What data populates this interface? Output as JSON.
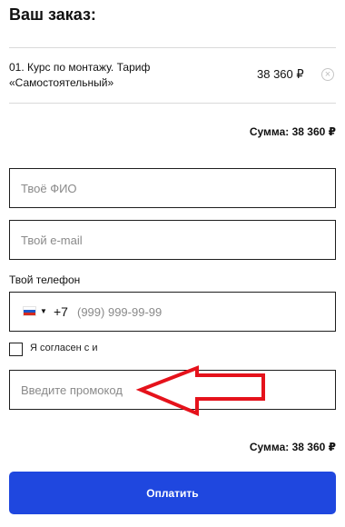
{
  "order": {
    "title": "Ваш заказ:",
    "item": {
      "name": "01. Курс по монтажу. Тариф «Самостоятельный»",
      "price": "38 360 ₽",
      "remove_icon": "close-circle-icon"
    },
    "sum_top": "Сумма: 38 360 ₽",
    "sum_bottom": "Сумма: 38 360 ₽"
  },
  "form": {
    "name_placeholder": "Твоё ФИО",
    "email_placeholder": "Твой e-mail",
    "phone_label": "Твой телефон",
    "phone_country_icon": "russia-flag-icon",
    "phone_code": "+7",
    "phone_placeholder": "(999) 999-99-99",
    "agree_label": "Я согласен с и",
    "agree_checked": false,
    "promo_placeholder": "Введите промокод"
  },
  "annotation": {
    "icon": "arrow-left-icon",
    "color": "#e5121b"
  },
  "pay_button": {
    "label": "Оплатить",
    "color": "#1f47df"
  }
}
